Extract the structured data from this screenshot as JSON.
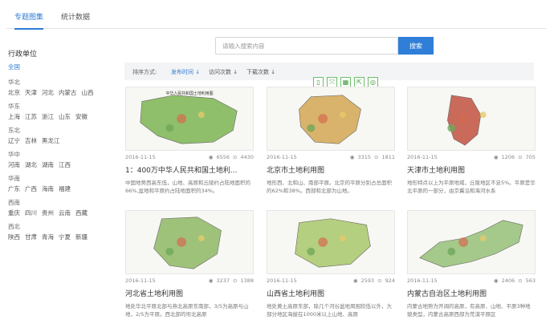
{
  "tabs": [
    {
      "label": "专题图集",
      "active": true
    },
    {
      "label": "统计数据",
      "active": false
    }
  ],
  "search": {
    "placeholder": "请输入搜索内容",
    "button_label": "搜索"
  },
  "sidebar": {
    "title": "行政单位",
    "all_label": "全国",
    "regions": [
      {
        "name": "华北",
        "provinces": [
          "北京",
          "天津",
          "河北",
          "内蒙古",
          "山西"
        ]
      },
      {
        "name": "华东",
        "provinces": [
          "上海",
          "江苏",
          "浙江",
          "山东",
          "安徽"
        ]
      },
      {
        "name": "东北",
        "provinces": [
          "辽宁",
          "吉林",
          "黑龙江"
        ]
      },
      {
        "name": "华中",
        "provinces": [
          "河南",
          "湖北",
          "湖南",
          "江西"
        ]
      },
      {
        "name": "华南",
        "provinces": [
          "广东",
          "广西",
          "海南",
          "福建"
        ]
      },
      {
        "name": "西南",
        "provinces": [
          "重庆",
          "四川",
          "贵州",
          "云南",
          "西藏"
        ]
      },
      {
        "name": "西北",
        "provinces": [
          "陕西",
          "甘肃",
          "青海",
          "宁夏",
          "新疆"
        ]
      }
    ]
  },
  "sort": {
    "label": "排序方式:",
    "options": [
      {
        "label": "发布时间 ↓",
        "active": true
      },
      {
        "label": "访问次数 ↓",
        "active": false
      },
      {
        "label": "下载次数 ↓",
        "active": false
      }
    ]
  },
  "toolbar": {
    "icons": [
      "▯",
      "⤧",
      "▦",
      "⇱",
      "◎"
    ]
  },
  "cards": [
    {
      "date": "2016-11-15",
      "views": "6556",
      "downloads": "4430",
      "title": "1：400万中华人民共和国土地利...",
      "desc": "中国地势西高东低，山地、高原和丘陵约占陆地面积的66%,盆地和平原约占陆地面积的34%。",
      "map_title": "中华人民共和国土地利用图"
    },
    {
      "date": "2016-11-15",
      "views": "3315",
      "downloads": "1811",
      "title": "北京市土地利用图",
      "desc": "地形西、北和山、南部平原。北京的平原分别占总面积的62%和38%。西部和北部为山地。",
      "map_title": ""
    },
    {
      "date": "2016-11-15",
      "views": "1206",
      "downloads": "705",
      "title": "天津市土地利用图",
      "desc": "地形特点以上为平原地域，丘陵地区不足5%。平原是华北平原的一部分，由京冀沿和海河水系",
      "map_title": ""
    },
    {
      "date": "2016-11-15",
      "views": "3237",
      "downloads": "1388",
      "title": "河北省土地利用图",
      "desc": "地处华北平原北部与燕北高原东南部，3/5为高原与山地，2/5为平原。西北部的坝北高原",
      "map_title": ""
    },
    {
      "date": "2016-11-15",
      "views": "2593",
      "downloads": "924",
      "title": "山西省土地利用图",
      "desc": "地处黄土高原东部，除几个河谷盆地周围较低以外，大部分地区海拔在1000米以上山地、高原",
      "map_title": ""
    },
    {
      "date": "2016-11-15",
      "views": "2406",
      "downloads": "563",
      "title": "内蒙古自治区土地利用图",
      "desc": "内蒙古地势为开阔的高原，有高原、山地、平原3种地貌类型，内蒙古高原西部为荒漠平原区",
      "map_title": ""
    }
  ],
  "colors": {
    "accent": "#2e7bd6",
    "tool_border": "#6cbf6c"
  }
}
